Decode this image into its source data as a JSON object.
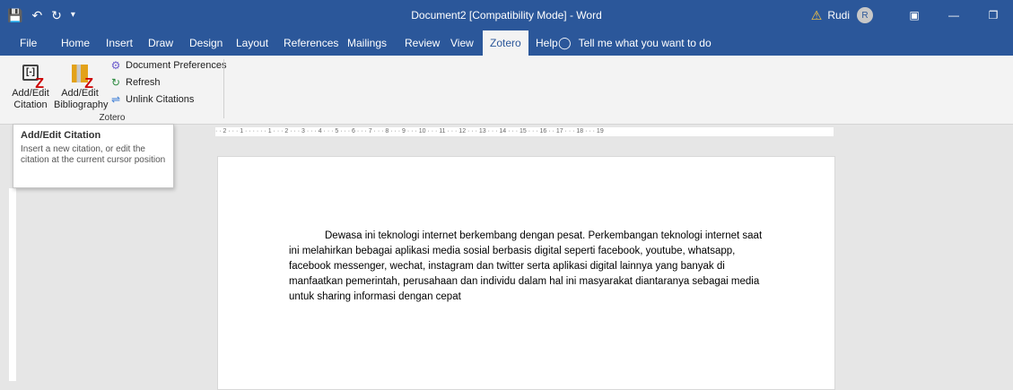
{
  "window": {
    "title": "Document2 [Compatibility Mode]  -  Word",
    "user_name": "Rudi",
    "user_initial": "R",
    "warning_icon": "warning-icon",
    "controls": [
      "ribbon-display-icon",
      "minimize-icon",
      "restore-icon"
    ]
  },
  "qat": {
    "save_icon": "save-icon",
    "undo_icon": "undo-icon",
    "redo_icon": "redo-icon",
    "customize_icon": "chevron-down-icon"
  },
  "tabs": [
    {
      "label": "File",
      "active": false
    },
    {
      "label": "Home",
      "active": false
    },
    {
      "label": "Insert",
      "active": false
    },
    {
      "label": "Draw",
      "active": false
    },
    {
      "label": "Design",
      "active": false
    },
    {
      "label": "Layout",
      "active": false
    },
    {
      "label": "References",
      "active": false
    },
    {
      "label": "Mailings",
      "active": false
    },
    {
      "label": "Review",
      "active": false
    },
    {
      "label": "View",
      "active": false
    },
    {
      "label": "Zotero",
      "active": true
    },
    {
      "label": "Help",
      "active": false
    }
  ],
  "tell_me": "Tell me what you want to do",
  "ribbon": {
    "add_edit_citation_line1": "Add/Edit",
    "add_edit_citation_line2": "Citation",
    "add_edit_bibliography_line1": "Add/Edit",
    "add_edit_bibliography_line2": "Bibliography",
    "document_preferences": "Document Preferences",
    "refresh": "Refresh",
    "unlink_citations": "Unlink Citations",
    "group_label": "Zotero"
  },
  "tooltip": {
    "title": "Add/Edit Citation",
    "body": "Insert a new citation, or edit the citation at the current cursor position"
  },
  "ruler_text": "· · 2 · · · 1 · · ·   · · · 1 · · · 2 · · · 3 · · · 4 · · · 5 · · · 6 · · · 7 · · · 8 · · · 9 · · · 10 · · · 11 · · · 12 · · · 13 · · · 14 · · · 15 · · · 16 ·   · 17 · · · 18 · · · 19",
  "document": {
    "paragraph": "Dewasa ini teknologi internet berkembang dengan pesat. Perkembangan teknologi internet saat ini melahirkan bebagai aplikasi media sosial berbasis digital seperti facebook, youtube, whatsapp, facebook messenger, wechat, instagram dan twitter serta aplikasi digital lainnya yang banyak di manfaatkan pemerintah, perusahaan dan individu dalam hal ini masyarakat diantaranya sebagai media untuk sharing informasi dengan cepat"
  }
}
